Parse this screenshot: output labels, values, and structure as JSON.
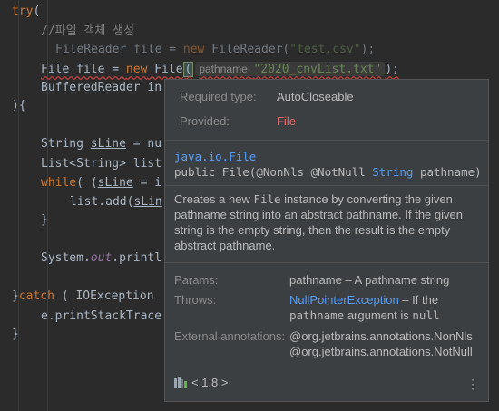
{
  "editor": {
    "lines": [
      {
        "kw": "try",
        "rest": "("
      },
      {
        "comment": "//파일 객체 생성"
      },
      {
        "pre": "FileReader file = ",
        "kw": "new",
        "post": " FileReader(",
        "str": "\"test.csv\"",
        "end": ");"
      },
      {
        "pre": "File file = ",
        "kw": "new",
        "post": " File",
        "paren": "(",
        "hint_label": "pathname:",
        "hint_value": "\"2020_cnvList.txt\"",
        "end": ");"
      },
      {
        "text": "BufferedReader in"
      },
      {
        "text": "){"
      },
      {
        "pre": "String ",
        "var": "sLine",
        "post": " = nu"
      },
      {
        "text": "List<String> list"
      },
      {
        "kw": "while",
        "pre": "( (",
        "var": "sLine",
        "post": " = i"
      },
      {
        "pre": "list.add(",
        "var": "sLin"
      },
      {
        "text": "}"
      },
      {
        "pre": "System.",
        "italic": "out",
        "post": ".printl"
      },
      {
        "pre": "}",
        "kw": "catch",
        "post": " ( IOException"
      },
      {
        "text": "e.printStackTrace"
      },
      {
        "text": "}"
      }
    ]
  },
  "popup": {
    "required_type_label": "Required type:",
    "required_type_value": "AutoCloseable",
    "provided_label": "Provided:",
    "provided_value": "File",
    "signature_package": "java.io.File",
    "signature_prefix": "public ",
    "signature_name": "File",
    "signature_params_a": "(@NonNls @NotNull ",
    "signature_param_type": "String",
    "signature_params_b": " pathname)",
    "description": [
      {
        "t": "Creates a new "
      },
      {
        "t": "File",
        "mono": true
      },
      {
        "t": " instance by converting the given pathname string into an abstract pathname. If the given string is the empty string, then the result is the empty abstract pathname."
      }
    ],
    "params_label": "Params:",
    "params_value": "pathname – A pathname string",
    "throws_label": "Throws:",
    "throws_link": "NullPointerException",
    "throws_text_a": " – If the ",
    "throws_code": "pathname",
    "throws_text_b": " argument is ",
    "throws_null": "null",
    "ext_label": "External annotations:",
    "ext_value": "@org.jetbrains.annotations.NonNls @org.jetbrains.annotations.NotNull",
    "jdk_version": "< 1.8 >",
    "jdk_icon": "library-icon",
    "more_icon": "more-vertical-icon",
    "more_glyph": "⋮"
  }
}
